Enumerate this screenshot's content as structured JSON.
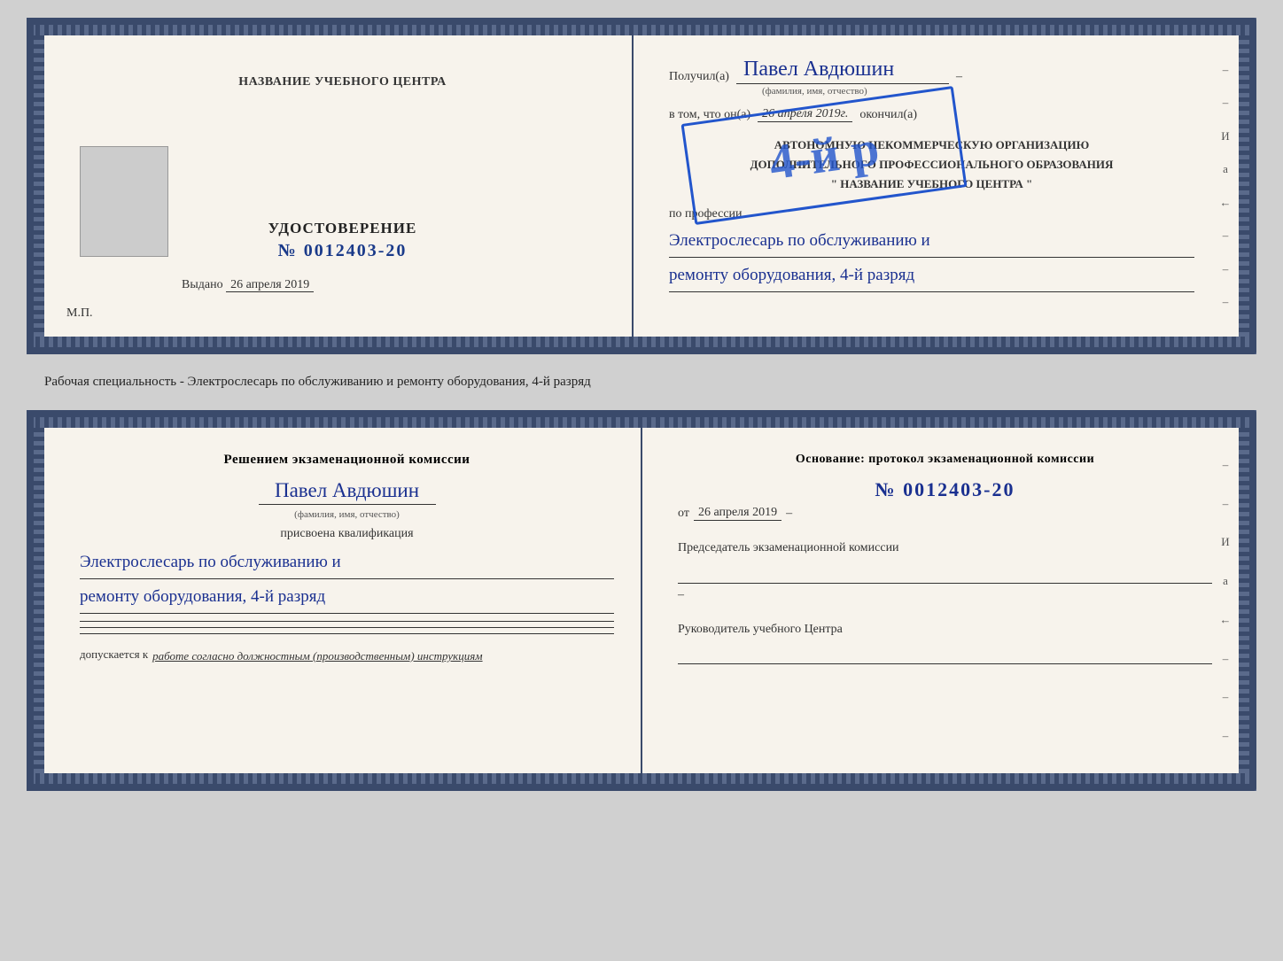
{
  "top_doc": {
    "left": {
      "center_title": "НАЗВАНИЕ УЧЕБНОГО ЦЕНТРА",
      "cert_label": "УДОСТОВЕРЕНИЕ",
      "cert_number": "№ 0012403-20",
      "issued_label": "Выдано",
      "issued_date": "26 апреля 2019",
      "mp_label": "М.П."
    },
    "right": {
      "recipient_label": "Получил(а)",
      "recipient_name": "Павел Авдюшин",
      "fio_subtitle": "(фамилия, имя, отчество)",
      "in_that_label": "в том, что он(а)",
      "in_that_date": "26 апреля 2019г.",
      "finished_label": "окончил(а)",
      "org_line1": "АВТОНОМНУЮ НЕКОММЕРЧЕСКУЮ ОРГАНИЗАЦИЮ",
      "org_line2": "ДОПОЛНИТЕЛЬНОГО ПРОФЕССИОНАЛЬНОГО ОБРАЗОВАНИЯ",
      "org_line3": "\" НАЗВАНИЕ УЧЕБНОГО ЦЕНТРА \"",
      "profession_label": "по профессии",
      "profession_line1": "Электрослесарь по обслуживанию и",
      "profession_line2": "ремонту оборудования, 4-й разряд",
      "stamp_text": "4-й р"
    }
  },
  "subtitle": "Рабочая специальность - Электрослесарь по обслуживанию и ремонту оборудования, 4-й разряд",
  "bottom_doc": {
    "left": {
      "decision_title": "Решением экзаменационной комиссии",
      "person_name": "Павел Авдюшин",
      "fio_subtitle": "(фамилия, имя, отчество)",
      "qualification_label": "присвоена квалификация",
      "qualification_line1": "Электрослесарь по обслуживанию и",
      "qualification_line2": "ремонту оборудования, 4-й разряд",
      "allowed_label": "допускается к",
      "allowed_value": "работе согласно должностным (производственным) инструкциям"
    },
    "right": {
      "basis_title": "Основание: протокол экзаменационной комиссии",
      "protocol_number": "№ 0012403-20",
      "protocol_date_label": "от",
      "protocol_date": "26 апреля 2019",
      "chairman_label": "Председатель экзаменационной комиссии",
      "head_label": "Руководитель учебного Центра"
    }
  },
  "side_chars": [
    "–",
    "–",
    "И",
    "а",
    "←",
    "–",
    "–",
    "–"
  ]
}
